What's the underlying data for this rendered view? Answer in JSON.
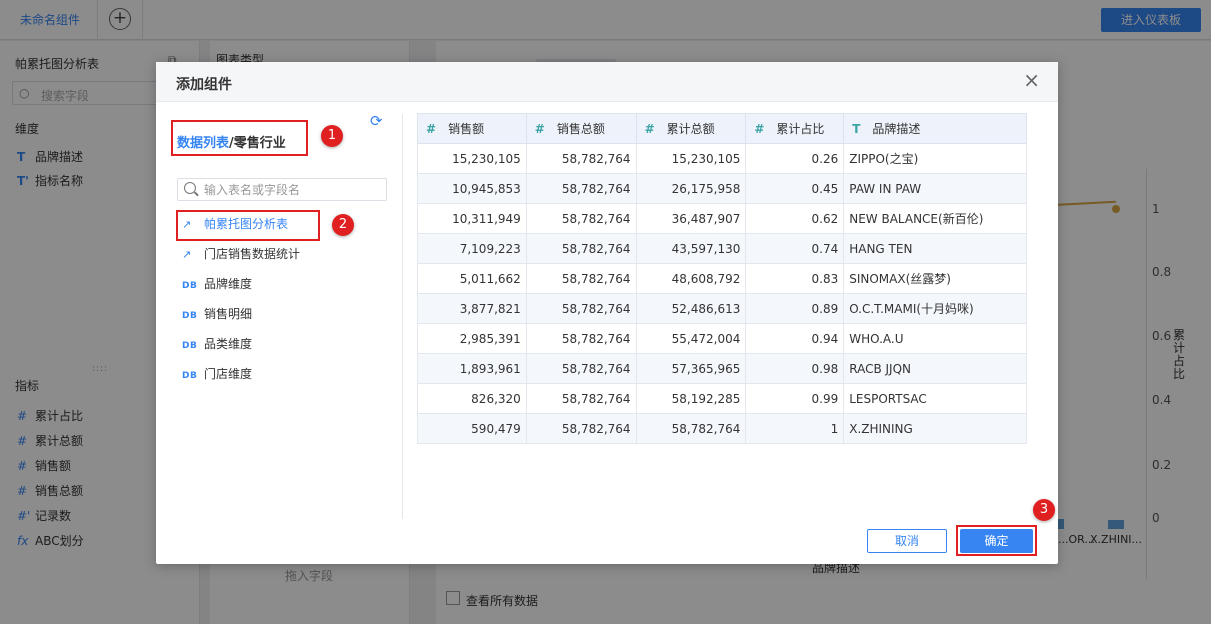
{
  "app": {
    "tab_label": "未命名组件",
    "add_tab_symbol": "+",
    "enter_dashboard_label": "进入仪表板"
  },
  "left_panel": {
    "title": "帕累托图分析表",
    "search_placeholder": "搜索字段",
    "dimension_section": "维度",
    "dimensions": [
      {
        "icon": "T",
        "label": "品牌描述"
      },
      {
        "icon": "T'",
        "label": "指标名称"
      }
    ],
    "measure_section": "指标",
    "measures": [
      {
        "icon": "#",
        "label": "累计占比"
      },
      {
        "icon": "#",
        "label": "累计总额"
      },
      {
        "icon": "#",
        "label": "销售额"
      },
      {
        "icon": "#",
        "label": "销售总额"
      },
      {
        "icon": "#'",
        "label": "记录数"
      },
      {
        "icon": "fx",
        "label": "ABC划分"
      }
    ]
  },
  "mid_panel": {
    "title": "图表类型",
    "drag_hint": "拖入字段"
  },
  "chart_bg": {
    "y_ticks": [
      "1",
      "0.8",
      "0.6",
      "0.4",
      "0.2",
      "0"
    ],
    "y_label": "累计占比",
    "x_labels": [
      "...OR...",
      "X.ZHINI..."
    ],
    "x_title": "品牌描述",
    "show_all_label": "查看所有数据"
  },
  "dialog": {
    "title": "添加组件",
    "close_symbol": "×",
    "breadcrumb": {
      "link": "数据列表",
      "separator": "/",
      "current": "零售行业"
    },
    "search_placeholder": "输入表名或字段名",
    "tables": [
      {
        "icon": "↗",
        "label": "帕累托图分析表",
        "selected": true
      },
      {
        "icon": "↗",
        "label": "门店销售数据统计"
      },
      {
        "icon": "DB",
        "label": "品牌维度"
      },
      {
        "icon": "DB",
        "label": "销售明细"
      },
      {
        "icon": "DB",
        "label": "品类维度"
      },
      {
        "icon": "DB",
        "label": "门店维度"
      }
    ],
    "columns": [
      {
        "icon": "#",
        "label": "销售额"
      },
      {
        "icon": "#",
        "label": "销售总额"
      },
      {
        "icon": "#",
        "label": "累计总额"
      },
      {
        "icon": "#",
        "label": "累计占比"
      },
      {
        "icon": "T",
        "label": "品牌描述"
      }
    ],
    "rows": [
      [
        "15,230,105",
        "58,782,764",
        "15,230,105",
        "0.26",
        "ZIPPO(之宝)"
      ],
      [
        "10,945,853",
        "58,782,764",
        "26,175,958",
        "0.45",
        "PAW IN PAW"
      ],
      [
        "10,311,949",
        "58,782,764",
        "36,487,907",
        "0.62",
        "NEW BALANCE(新百伦)"
      ],
      [
        "7,109,223",
        "58,782,764",
        "43,597,130",
        "0.74",
        "HANG TEN"
      ],
      [
        "5,011,662",
        "58,782,764",
        "48,608,792",
        "0.83",
        "SINOMAX(丝露梦)"
      ],
      [
        "3,877,821",
        "58,782,764",
        "52,486,613",
        "0.89",
        "O.C.T.MAMI(十月妈咪)"
      ],
      [
        "2,985,391",
        "58,782,764",
        "55,472,004",
        "0.94",
        "WHO.A.U"
      ],
      [
        "1,893,961",
        "58,782,764",
        "57,365,965",
        "0.98",
        "RACB JJQN"
      ],
      [
        "826,320",
        "58,782,764",
        "58,192,285",
        "0.99",
        "LESPORTSAC"
      ],
      [
        "590,479",
        "58,782,764",
        "58,782,764",
        "1",
        "X.ZHINING"
      ]
    ],
    "cancel_label": "取消",
    "ok_label": "确定",
    "badges": [
      "1",
      "2",
      "3"
    ]
  }
}
